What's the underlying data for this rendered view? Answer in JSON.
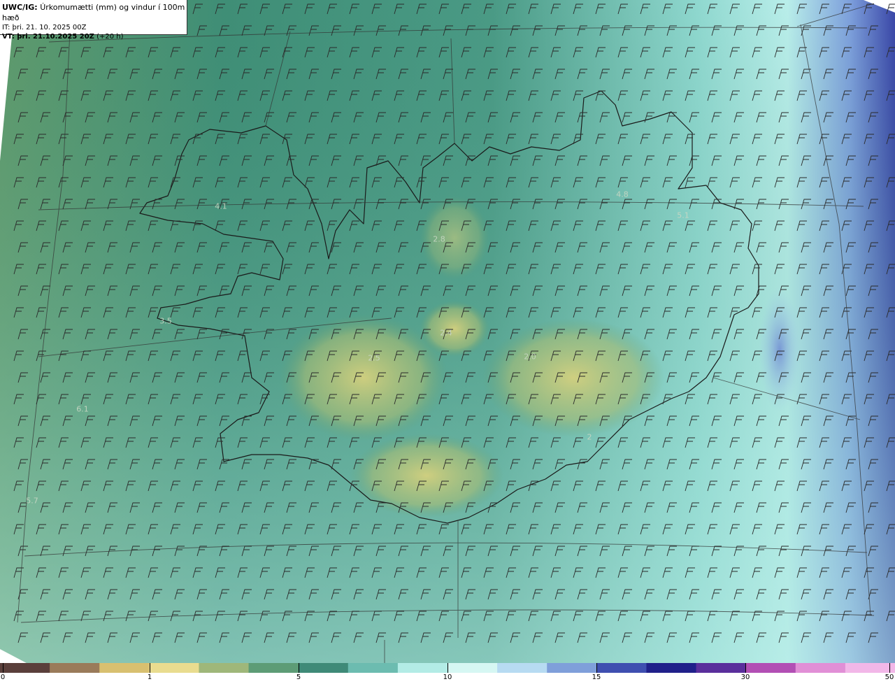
{
  "header": {
    "model": "UWC/IG:",
    "title": "Úrkomumætti (mm) og vindur í 100m hæð",
    "init_label": "IT:",
    "init_time": "þri. 21. 10. 2025 00Z",
    "valid_label": "VT:",
    "valid_time": "þri. 21.10.2025 20Z",
    "lead": "(+20 h)"
  },
  "map_values": [
    {
      "text": "4.1"
    },
    {
      "text": "2.8"
    },
    {
      "text": "4.8"
    },
    {
      "text": "5.1"
    },
    {
      "text": "3.5"
    },
    {
      "text": "2.4"
    },
    {
      "text": "2.5"
    },
    {
      "text": "2.0"
    },
    {
      "text": "6.1"
    },
    {
      "text": "2"
    },
    {
      "text": "5.7"
    }
  ],
  "colorbar": {
    "ticks": [
      "0",
      "1",
      "5",
      "10",
      "15",
      "30",
      "50"
    ],
    "colors": [
      "#5a3f3b",
      "#9a7b5a",
      "#d8c070",
      "#e9dc8f",
      "#9fb77a",
      "#5d9c76",
      "#3f8a78",
      "#6cbcb0",
      "#b3ece6",
      "#d6f7f3",
      "#b7dbf2",
      "#7f9fda",
      "#3f4fb0",
      "#20208a",
      "#5a2f9c",
      "#b24fb4",
      "#e18fd6",
      "#f2b7e8"
    ]
  },
  "wind_icon": "wind-barb-icon",
  "colors": {
    "land_low": "#4f8d72",
    "land_dry": "#c8c97a",
    "sea": "#8fd3c8",
    "high_precip": "#3a46a8",
    "coast": "#1a1a1a"
  }
}
